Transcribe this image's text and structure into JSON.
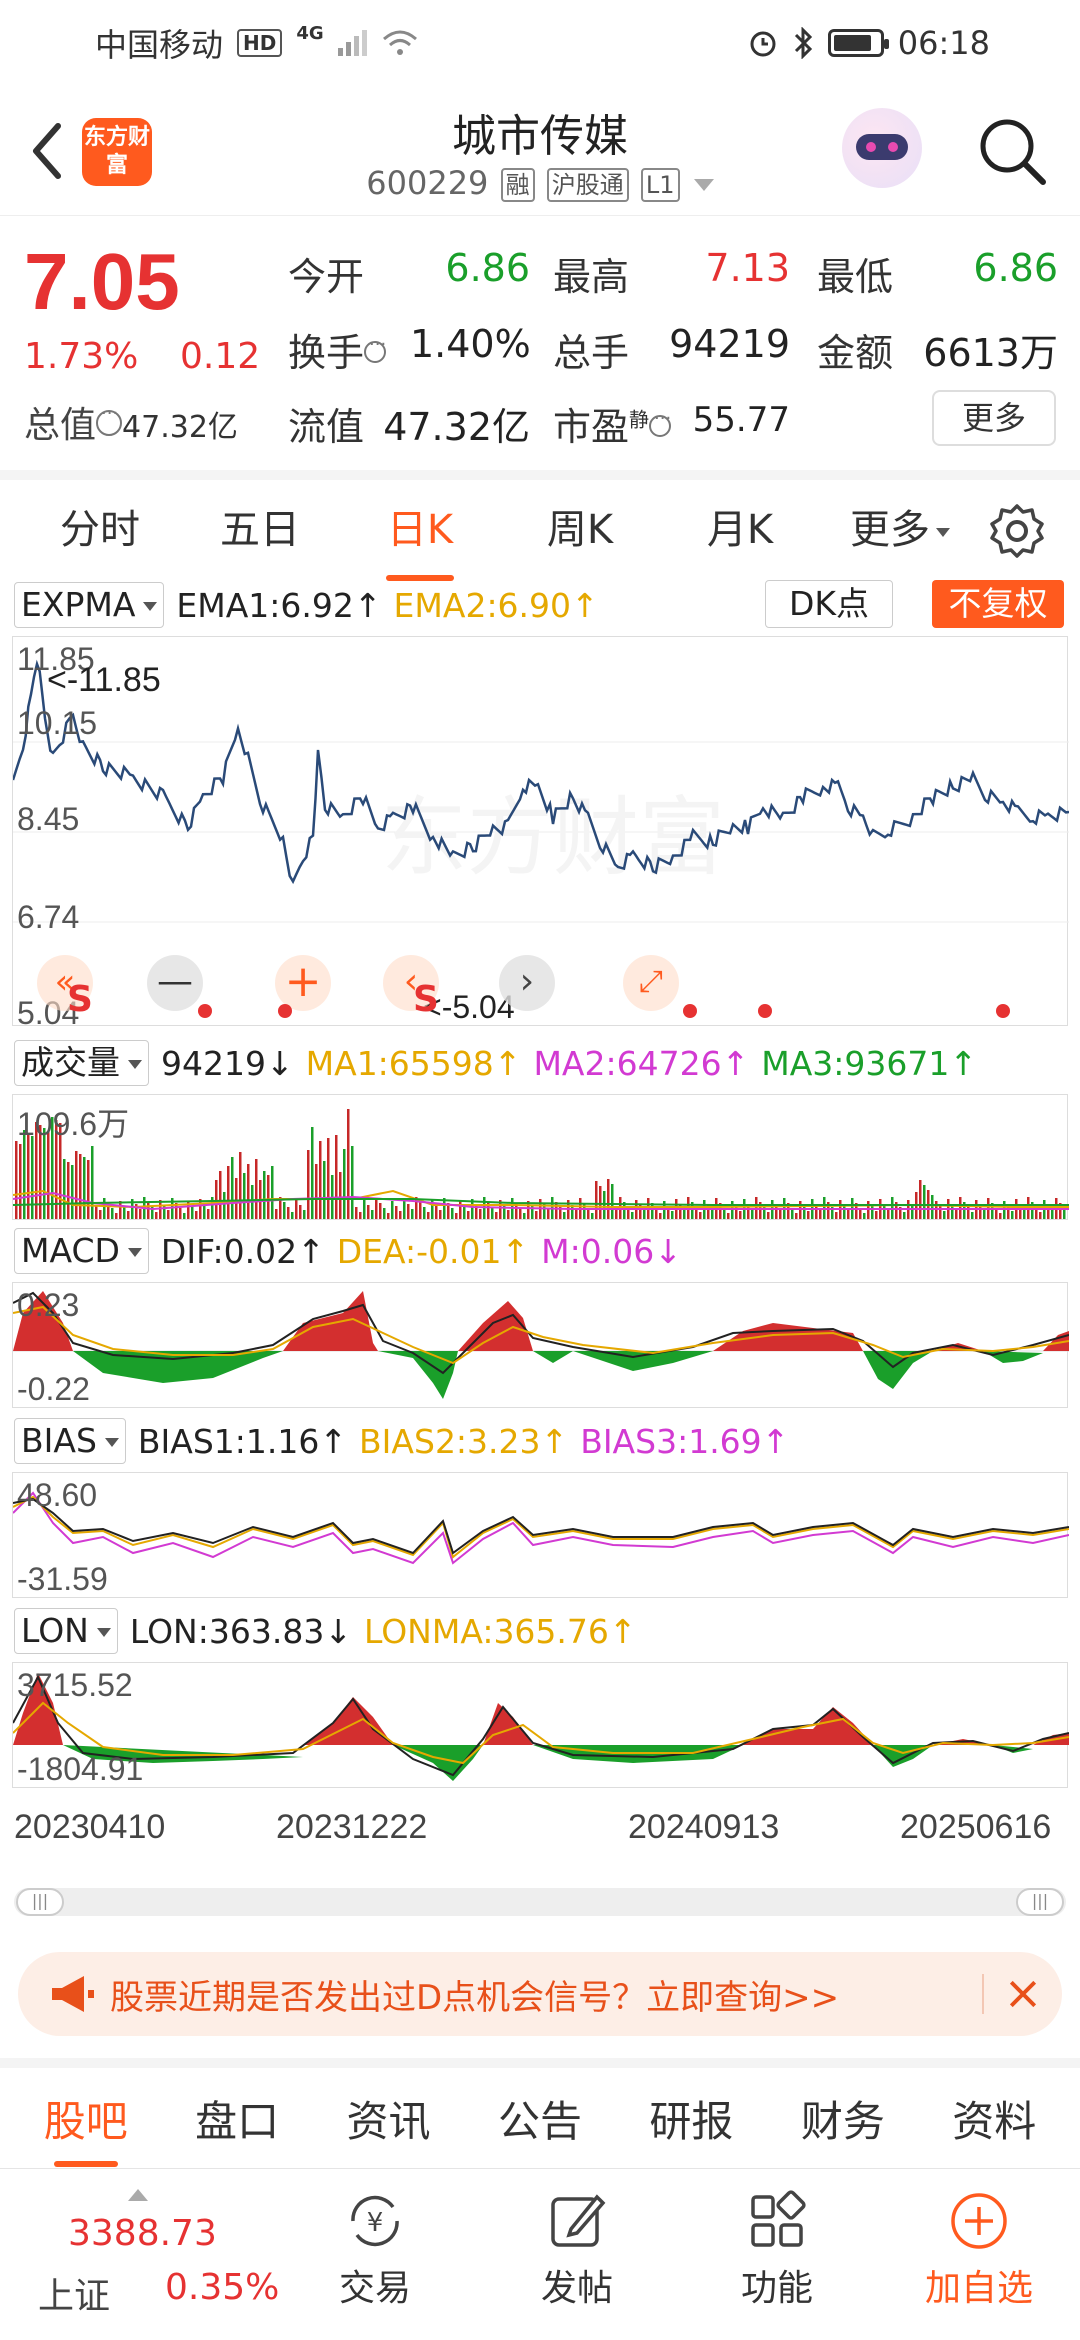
{
  "status_bar": {
    "carrier": "中国移动",
    "hd": "HD",
    "network": "4G",
    "time": "06:18"
  },
  "header": {
    "logo_text": "东方财富",
    "name": "城市传媒",
    "code": "600229",
    "tags": [
      "融",
      "沪股通",
      "L1"
    ]
  },
  "quote": {
    "price": "7.05",
    "change_pct": "1.73%",
    "change": "0.12",
    "total_value_label": "总值",
    "total_value": "47.32亿",
    "stats": [
      {
        "label": "今开",
        "value": "6.86"
      },
      {
        "label": "最高",
        "value": "7.13"
      },
      {
        "label": "最低",
        "value": "6.86"
      },
      {
        "label": "换手",
        "value": "1.40%"
      },
      {
        "label": "总手",
        "value": "94219"
      },
      {
        "label": "金额",
        "value": "6613万"
      },
      {
        "label": "流值",
        "value": "47.32亿"
      },
      {
        "label": "市盈",
        "sup": "静",
        "value": "55.77"
      }
    ],
    "more_label": "更多"
  },
  "colors": {
    "up": "#e63232",
    "down": "#1a9f2a",
    "accent": "#ff5a1e"
  },
  "tabs": [
    "分时",
    "五日",
    "日K",
    "周K",
    "月K",
    "更多"
  ],
  "active_tab": "日K",
  "indicators": {
    "expma": {
      "name": "EXPMA",
      "ema1": "EMA1:6.92↑",
      "ema2": "EMA2:6.90↑",
      "dk": "DK点",
      "fq": "不复权",
      "max_label": "11.85",
      "min_label": "5.04",
      "max_marker": "<-11.85",
      "min_marker": "<-5.04",
      "y_ticks": [
        "11.85",
        "10.15",
        "8.45",
        "6.74",
        "5.04"
      ]
    },
    "volume": {
      "name": "成交量",
      "value": "94219↓",
      "ma1": "MA1:65598↑",
      "ma2": "MA2:64726↑",
      "ma3": "MA3:93671↑",
      "max_label": "109.6万"
    },
    "macd": {
      "name": "MACD",
      "dif": "DIF:0.02↑",
      "dea": "DEA:-0.01↑",
      "m": "M:0.06↓",
      "max_label": "0.23",
      "min_label": "-0.22"
    },
    "bias": {
      "name": "BIAS",
      "b1": "BIAS1:1.16↑",
      "b2": "BIAS2:3.23↑",
      "b3": "BIAS3:1.69↑",
      "max_label": "48.60",
      "min_label": "-31.59"
    },
    "lon": {
      "name": "LON",
      "lon": "LON:363.83↓",
      "lonma": "LONMA:365.76↑",
      "max_label": "3715.52",
      "min_label": "-1804.91"
    }
  },
  "chart_controls": {
    "signal_s": "S"
  },
  "dates": [
    "20230410",
    "20231222",
    "20240913",
    "20250616"
  ],
  "banner": {
    "text": "股票近期是否发出过D点机会信号？立即查询>>"
  },
  "bottom_tabs": [
    "股吧",
    "盘口",
    "资讯",
    "公告",
    "研报",
    "财务",
    "资料"
  ],
  "bottom_nav": {
    "index_value": "3388.73",
    "index_name": "上证",
    "index_pct": "0.35%",
    "items": [
      "交易",
      "发帖",
      "功能",
      "加自选"
    ]
  }
}
